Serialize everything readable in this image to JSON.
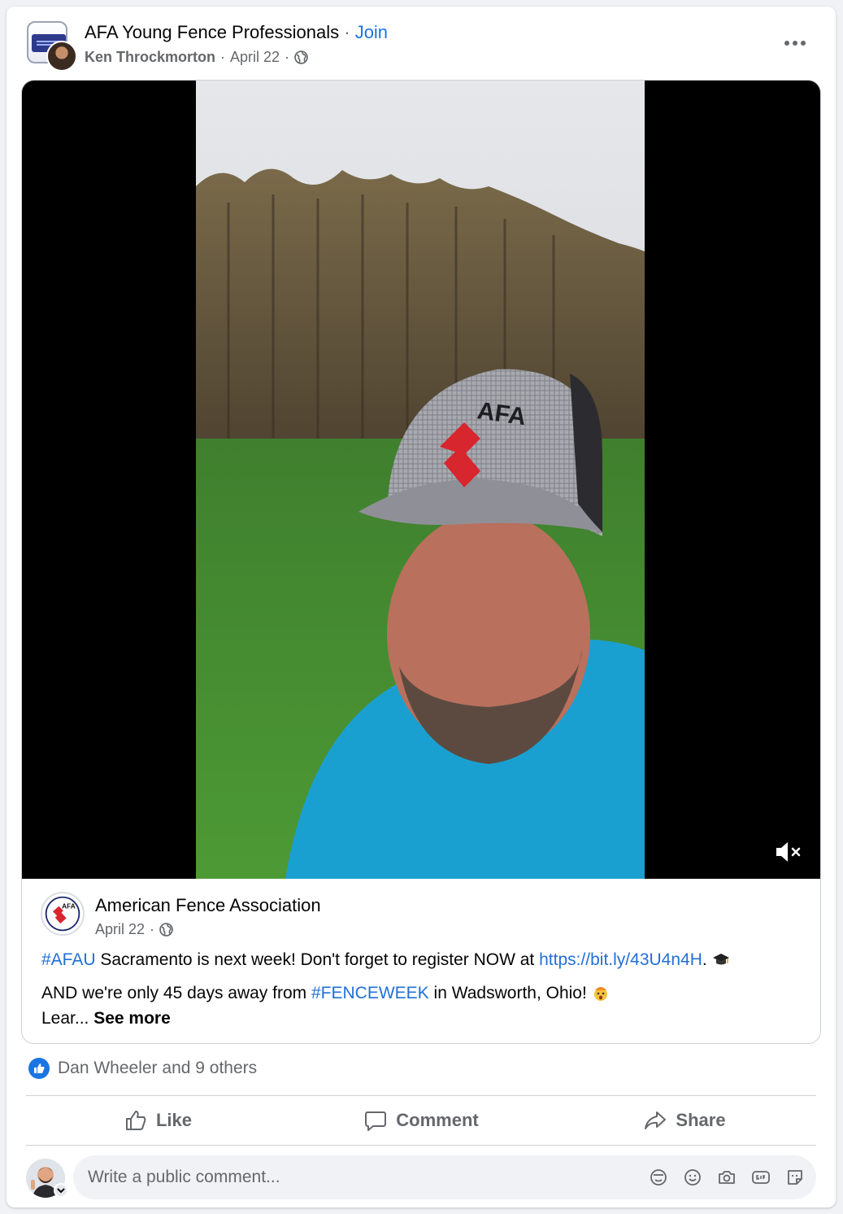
{
  "group": {
    "name": "AFA Young Fence Professionals",
    "separator": "·",
    "join_label": "Join"
  },
  "post": {
    "author": "Ken Throckmorton",
    "date": "April 22",
    "meta_separator": "·"
  },
  "video": {
    "cap_text": "AFA",
    "muted": true
  },
  "shared": {
    "page_name": "American Fence Association",
    "date": "April 22",
    "meta_separator": "·",
    "logo_text": "AFA",
    "line1": {
      "hashtag": "#AFAU",
      "text_a": " Sacramento is next week! Don't forget to register NOW at ",
      "link": "https://bit.ly/43U4n4H",
      "text_b": ". "
    },
    "line2": {
      "text_a": "AND we're only 45 days away from ",
      "hashtag": "#FENCEWEEK",
      "text_b": " in Wadsworth, Ohio! "
    },
    "line3": {
      "truncated": "Lear... ",
      "see_more": "See more"
    }
  },
  "reactions": {
    "summary": "Dan Wheeler and 9 others"
  },
  "actions": {
    "like": "Like",
    "comment": "Comment",
    "share": "Share"
  },
  "composer": {
    "placeholder": "Write a public comment...",
    "icons": [
      "avatar-sticker-icon",
      "emoji-icon",
      "camera-icon",
      "gif-icon",
      "sticker-icon"
    ]
  },
  "colors": {
    "link_blue": "#1b74e4",
    "hashtag_blue": "#2270d6",
    "secondary_text": "#65676b",
    "afa_red": "#d7262e",
    "shirt_blue": "#1aa0d0"
  }
}
